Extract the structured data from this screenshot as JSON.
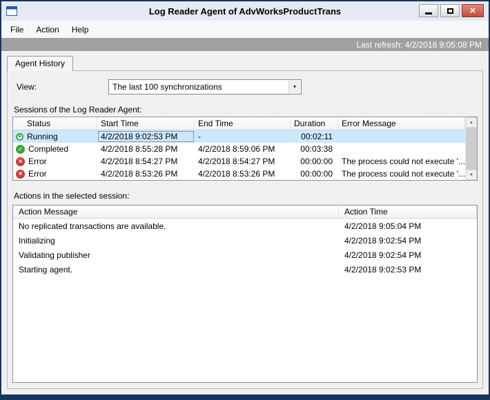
{
  "window": {
    "title": "Log Reader Agent of AdvWorksProductTrans",
    "status_strip": "Last refresh: 4/2/2018 9:05:08 PM"
  },
  "menu": {
    "items": [
      "File",
      "Action",
      "Help"
    ]
  },
  "tab": {
    "label": "Agent History"
  },
  "view": {
    "label": "View:",
    "selected_option": "The last 100 synchronizations"
  },
  "sessions": {
    "section_label": "Sessions of the Log Reader Agent:",
    "columns": [
      "Status",
      "Start Time",
      "End Time",
      "Duration",
      "Error Message"
    ],
    "rows": [
      {
        "status": "Running",
        "start": "4/2/2018 9:02:53 PM",
        "end": "-",
        "duration": "00:02:11",
        "error": ""
      },
      {
        "status": "Completed",
        "start": "4/2/2018 8:55:28 PM",
        "end": "4/2/2018 8:59:06 PM",
        "duration": "00:03:38",
        "error": ""
      },
      {
        "status": "Error",
        "start": "4/2/2018 8:54:27 PM",
        "end": "4/2/2018 8:54:27 PM",
        "duration": "00:00:00",
        "error": "The process could not execute '..."
      },
      {
        "status": "Error",
        "start": "4/2/2018 8:53:26 PM",
        "end": "4/2/2018 8:53:26 PM",
        "duration": "00:00:00",
        "error": "The process could not execute '..."
      }
    ]
  },
  "actions": {
    "section_label": "Actions in the selected session:",
    "columns": [
      "Action Message",
      "Action Time"
    ],
    "rows": [
      {
        "message": "No replicated transactions are available.",
        "time": "4/2/2018 9:05:04 PM"
      },
      {
        "message": "Initializing",
        "time": "4/2/2018 9:02:54 PM"
      },
      {
        "message": "Validating publisher",
        "time": "4/2/2018 9:02:54 PM"
      },
      {
        "message": "Starting agent.",
        "time": "4/2/2018 9:02:53 PM"
      }
    ]
  },
  "icons": {
    "running": "▶",
    "completed": "✓",
    "error": "×",
    "combo_arrow": "▼",
    "scroll_up": "▲",
    "scroll_down": "▼",
    "close": "×"
  },
  "colors": {
    "selection": "#cce8ff",
    "running_green": "#3aa63a",
    "error_red": "#ce3a34",
    "close_red": "#c74b3c",
    "border_navy": "#16355e"
  }
}
